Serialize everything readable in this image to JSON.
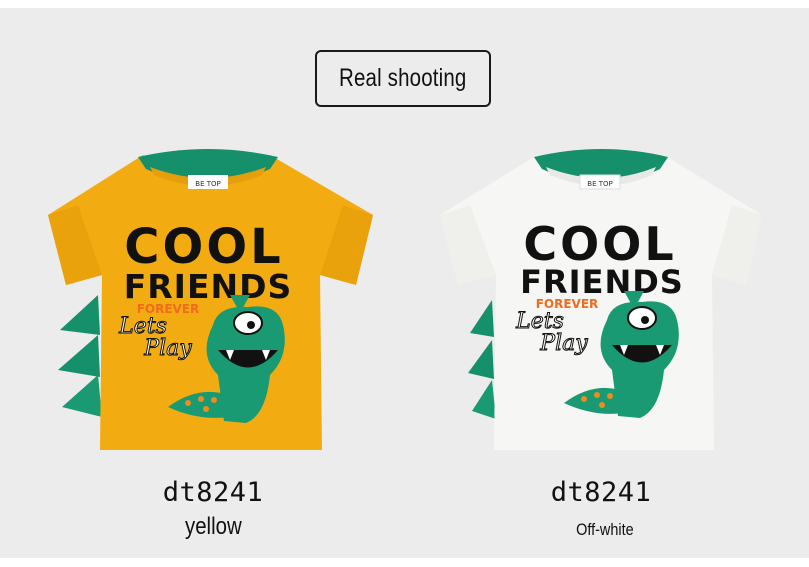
{
  "banner": {
    "title": "Real shooting"
  },
  "products": [
    {
      "code": "dt8241",
      "color_name": "yellow",
      "body_color": "#f2ac12",
      "trim_color": "#16906a",
      "print": {
        "line1": "COOL",
        "line2": "FRIENDS",
        "line3": "FOREVER",
        "line4": "Lets",
        "line5": "Play",
        "tag": "BE TOP"
      }
    },
    {
      "code": "dt8241",
      "color_name": "Off-white",
      "body_color": "#f6f6f4",
      "trim_color": "#16906a",
      "print": {
        "line1": "COOL",
        "line2": "FRIENDS",
        "line3": "FOREVER",
        "line4": "Lets",
        "line5": "Play",
        "tag": "BE TOP"
      }
    }
  ]
}
